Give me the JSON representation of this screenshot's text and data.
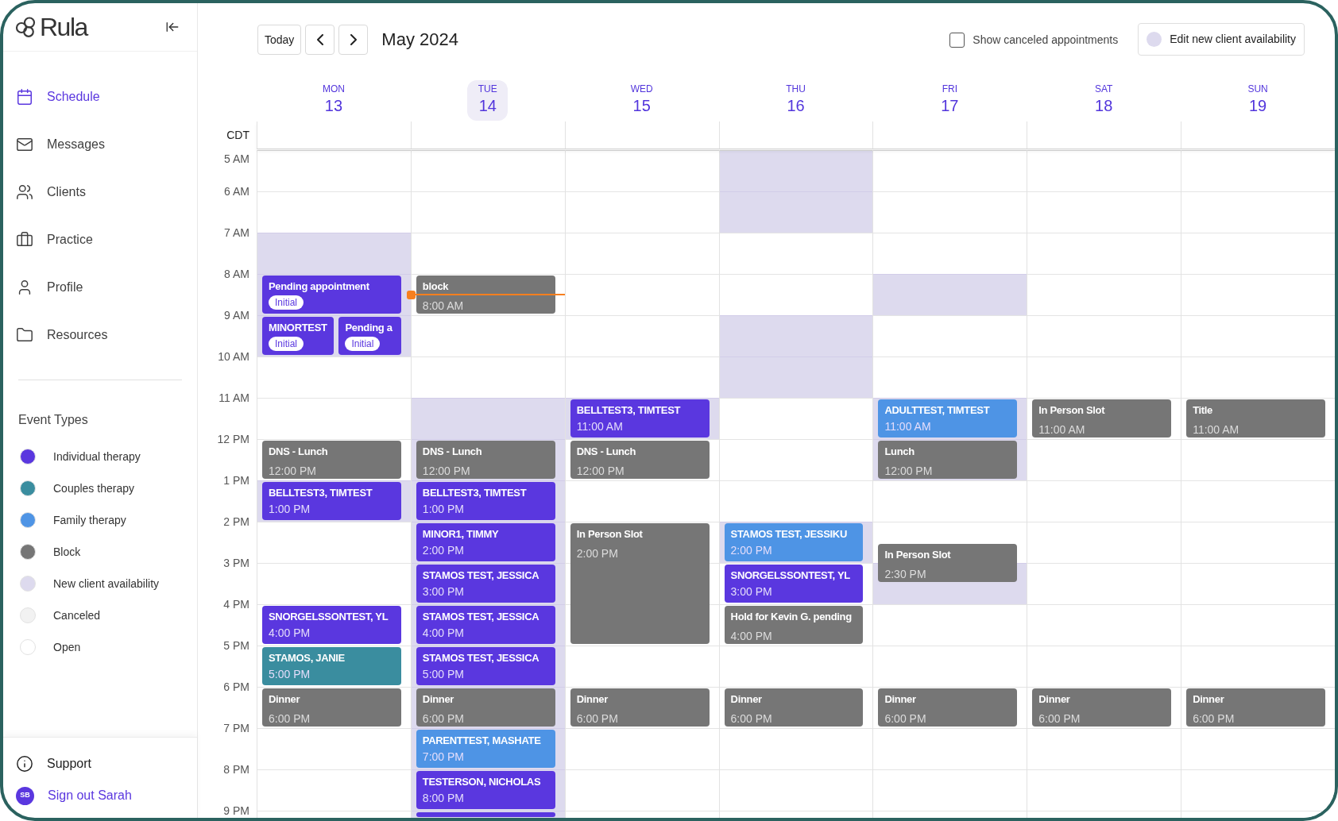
{
  "sidebar": {
    "logo": "Rula",
    "nav": [
      {
        "label": "Schedule",
        "selected": true
      },
      {
        "label": "Messages",
        "selected": false
      },
      {
        "label": "Clients",
        "selected": false
      },
      {
        "label": "Practice",
        "selected": false
      },
      {
        "label": "Profile",
        "selected": false
      },
      {
        "label": "Resources",
        "selected": false
      }
    ],
    "event_types": {
      "title": "Event Types",
      "items": [
        {
          "label": "Individual therapy",
          "color": "#5a37df"
        },
        {
          "label": "Couples therapy",
          "color": "#3a8d9f"
        },
        {
          "label": "Family therapy",
          "color": "#4e94e5"
        },
        {
          "label": "Block",
          "color": "#767676"
        },
        {
          "label": "New client availability",
          "color": "#dddaee"
        },
        {
          "label": "Canceled",
          "color": "#f2f2f2"
        },
        {
          "label": "Open",
          "color": "#ffffff"
        }
      ]
    },
    "support": "Support",
    "account": {
      "initials": "SB",
      "label": "Sign out Sarah"
    }
  },
  "toolbar": {
    "today": "Today",
    "title": "May 2024",
    "show_canceled": {
      "label": "Show canceled appointments",
      "checked": false
    },
    "availability_button": "Edit new client availability"
  },
  "calendar": {
    "timezone": "CDT",
    "hours": [
      "5 AM",
      "6 AM",
      "7 AM",
      "8 AM",
      "9 AM",
      "10 AM",
      "11 AM",
      "12 PM",
      "1 PM",
      "2 PM",
      "3 PM",
      "4 PM",
      "5 PM",
      "6 PM",
      "7 PM",
      "8 PM",
      "9 PM"
    ],
    "days": [
      {
        "weekday": "MON",
        "date": "13",
        "today": false,
        "slots": [
          {
            "available": false
          },
          {
            "available": false
          },
          {
            "available": true
          },
          {
            "available": true
          },
          {
            "available": true
          },
          {
            "available": false
          },
          {
            "available": false
          },
          {
            "available": false
          },
          {
            "available": true
          },
          {
            "available": false
          },
          {
            "available": false
          },
          {
            "available": false
          },
          {
            "available": false
          },
          {
            "available": false
          },
          {
            "available": false
          },
          {
            "available": false
          },
          {
            "available": false
          }
        ],
        "events": [
          {
            "kind": "individual",
            "title": "Pending appointment",
            "badge": "Initial"
          },
          {
            "kind": "individual",
            "title": "MINORTEST",
            "badge": "Initial"
          },
          {
            "kind": "individual",
            "title": "Pending a",
            "badge": "Initial"
          },
          {
            "kind": "block",
            "title": "DNS - Lunch",
            "time": "12:00 PM"
          },
          {
            "kind": "individual",
            "title": "BELLTEST3, TIMTEST",
            "time": "1:00 PM"
          },
          {
            "kind": "individual",
            "title": "SNORGELSSONTEST, YL",
            "time": "4:00 PM"
          },
          {
            "kind": "couples",
            "title": "STAMOS, JANIE",
            "time": "5:00 PM"
          },
          {
            "kind": "block",
            "title": "Dinner",
            "time": "6:00 PM"
          }
        ]
      },
      {
        "weekday": "TUE",
        "date": "14",
        "today": true,
        "slots": [
          {
            "available": false
          },
          {
            "available": false
          },
          {
            "available": false
          },
          {
            "available": false
          },
          {
            "available": false
          },
          {
            "available": false
          },
          {
            "available": true
          },
          {
            "available": true
          },
          {
            "available": true
          },
          {
            "available": true
          },
          {
            "available": true
          },
          {
            "available": true
          },
          {
            "available": true
          },
          {
            "available": true
          },
          {
            "available": true
          },
          {
            "available": true
          },
          {
            "available": true
          }
        ],
        "events": [
          {
            "kind": "block",
            "title": "block",
            "time": "8:00 AM"
          },
          {
            "kind": "block",
            "title": "DNS - Lunch",
            "time": "12:00 PM"
          },
          {
            "kind": "individual",
            "title": "BELLTEST3, TIMTEST",
            "time": "1:00 PM"
          },
          {
            "kind": "individual",
            "title": "MINOR1, TIMMY",
            "time": "2:00 PM"
          },
          {
            "kind": "individual",
            "title": "STAMOS TEST, JESSICA",
            "time": "3:00 PM"
          },
          {
            "kind": "individual",
            "title": "STAMOS TEST, JESSICA",
            "time": "4:00 PM"
          },
          {
            "kind": "individual",
            "title": "STAMOS TEST, JESSICA",
            "time": "5:00 PM"
          },
          {
            "kind": "block",
            "title": "Dinner",
            "time": "6:00 PM"
          },
          {
            "kind": "family",
            "title": "PARENTTEST, MASHATE",
            "time": "7:00 PM"
          },
          {
            "kind": "individual",
            "title": "TESTERSON, NICHOLAS",
            "time": "8:00 PM"
          },
          {
            "kind": "individual"
          }
        ]
      },
      {
        "weekday": "WED",
        "date": "15",
        "today": false,
        "slots": [
          {
            "available": false
          },
          {
            "available": false
          },
          {
            "available": false
          },
          {
            "available": false
          },
          {
            "available": false
          },
          {
            "available": false
          },
          {
            "available": true
          },
          {
            "available": false
          },
          {
            "available": false
          },
          {
            "available": false
          },
          {
            "available": false
          },
          {
            "available": false
          },
          {
            "available": false
          },
          {
            "available": false
          },
          {
            "available": false
          },
          {
            "available": false
          },
          {
            "available": false
          }
        ],
        "events": [
          {
            "kind": "individual",
            "title": "BELLTEST3, TIMTEST",
            "time": "11:00 AM"
          },
          {
            "kind": "block",
            "title": "DNS - Lunch",
            "time": "12:00 PM"
          },
          {
            "kind": "block",
            "title": "In Person Slot",
            "time": "2:00 PM"
          },
          {
            "kind": "block",
            "title": "Dinner",
            "time": "6:00 PM"
          }
        ]
      },
      {
        "weekday": "THU",
        "date": "16",
        "today": false,
        "slots": [
          {
            "available": true
          },
          {
            "available": true
          },
          {
            "available": false
          },
          {
            "available": false
          },
          {
            "available": true
          },
          {
            "available": true
          },
          {
            "available": false
          },
          {
            "available": false
          },
          {
            "available": false
          },
          {
            "available": true
          },
          {
            "available": false
          },
          {
            "available": false
          },
          {
            "available": false
          },
          {
            "available": false
          },
          {
            "available": false
          },
          {
            "available": false
          },
          {
            "available": false
          }
        ],
        "events": [
          {
            "kind": "family",
            "title": "STAMOS TEST, JESSIKU",
            "time": "2:00 PM"
          },
          {
            "kind": "individual",
            "title": "SNORGELSSONTEST, YL",
            "time": "3:00 PM"
          },
          {
            "kind": "block",
            "title": "Hold for Kevin G. pending",
            "time": "4:00 PM"
          },
          {
            "kind": "block",
            "title": "Dinner",
            "time": "6:00 PM"
          }
        ]
      },
      {
        "weekday": "FRI",
        "date": "17",
        "today": false,
        "slots": [
          {
            "available": false
          },
          {
            "available": false
          },
          {
            "available": false
          },
          {
            "available": true
          },
          {
            "available": false
          },
          {
            "available": false
          },
          {
            "available": true
          },
          {
            "available": true
          },
          {
            "available": false
          },
          {
            "available": false
          },
          {
            "available": true
          },
          {
            "available": false
          },
          {
            "available": false
          },
          {
            "available": false
          },
          {
            "available": false
          },
          {
            "available": false
          },
          {
            "available": false
          }
        ],
        "events": [
          {
            "kind": "family",
            "title": "ADULTTEST, TIMTEST",
            "time": "11:00 AM"
          },
          {
            "kind": "block",
            "title": "Lunch",
            "time": "12:00 PM"
          },
          {
            "kind": "block",
            "title": "In Person Slot",
            "time": "2:30 PM"
          },
          {
            "kind": "block",
            "title": "Dinner",
            "time": "6:00 PM"
          }
        ]
      },
      {
        "weekday": "SAT",
        "date": "18",
        "today": false,
        "slots": [
          {
            "available": false
          },
          {
            "available": false
          },
          {
            "available": false
          },
          {
            "available": false
          },
          {
            "available": false
          },
          {
            "available": false
          },
          {
            "available": false
          },
          {
            "available": false
          },
          {
            "available": false
          },
          {
            "available": false
          },
          {
            "available": false
          },
          {
            "available": false
          },
          {
            "available": false
          },
          {
            "available": false
          },
          {
            "available": false
          },
          {
            "available": false
          },
          {
            "available": false
          }
        ],
        "events": [
          {
            "kind": "block",
            "title": "In Person Slot",
            "time": "11:00 AM"
          },
          {
            "kind": "block",
            "title": "Dinner",
            "time": "6:00 PM"
          }
        ]
      },
      {
        "weekday": "SUN",
        "date": "19",
        "today": false,
        "slots": [
          {
            "available": false
          },
          {
            "available": false
          },
          {
            "available": false
          },
          {
            "available": false
          },
          {
            "available": false
          },
          {
            "available": false
          },
          {
            "available": false
          },
          {
            "available": false
          },
          {
            "available": false
          },
          {
            "available": false
          },
          {
            "available": false
          },
          {
            "available": false
          },
          {
            "available": false
          },
          {
            "available": false
          },
          {
            "available": false
          },
          {
            "available": false
          },
          {
            "available": false
          }
        ],
        "events": [
          {
            "kind": "block",
            "title": "Title",
            "time": "11:00 AM"
          },
          {
            "kind": "block",
            "title": "Dinner",
            "time": "6:00 PM"
          }
        ]
      }
    ]
  }
}
